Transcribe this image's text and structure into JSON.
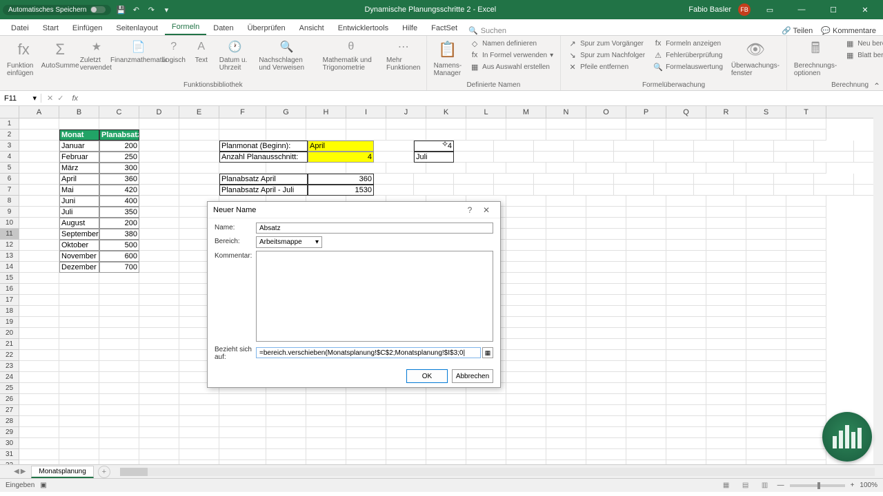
{
  "titlebar": {
    "autosave": "Automatisches Speichern",
    "title": "Dynamische Planungsschritte 2 - Excel",
    "user_name": "Fabio Basler",
    "user_initials": "FB"
  },
  "tabs": {
    "datei": "Datei",
    "start": "Start",
    "einfuegen": "Einfügen",
    "seitenlayout": "Seitenlayout",
    "formeln": "Formeln",
    "daten": "Daten",
    "ueberpruefen": "Überprüfen",
    "ansicht": "Ansicht",
    "entwicklertools": "Entwicklertools",
    "hilfe": "Hilfe",
    "factset": "FactSet",
    "suchen": "Suchen",
    "teilen": "Teilen",
    "kommentare": "Kommentare"
  },
  "ribbon": {
    "funktion_einfuegen": "Funktion einfügen",
    "autosumme": "AutoSumme",
    "zuletzt_verwendet": "Zuletzt verwendet",
    "finanzmathematik": "Finanzmathematik",
    "logisch": "Logisch",
    "text": "Text",
    "datum_uhrzeit": "Datum u. Uhrzeit",
    "nachschlagen": "Nachschlagen und Verweisen",
    "mathematik": "Mathematik und Trigonometrie",
    "mehr_funktionen": "Mehr Funktionen",
    "group_funktionsbibliothek": "Funktionsbibliothek",
    "namens_manager": "Namens-Manager",
    "namen_definieren": "Namen definieren",
    "in_formel_verwenden": "In Formel verwenden",
    "aus_auswahl_erstellen": "Aus Auswahl erstellen",
    "group_definierte_namen": "Definierte Namen",
    "spur_vorgaenger": "Spur zum Vorgänger",
    "spur_nachfolger": "Spur zum Nachfolger",
    "pfeile_entfernen": "Pfeile entfernen",
    "formeln_anzeigen": "Formeln anzeigen",
    "fehlerueberpruefung": "Fehlerüberprüfung",
    "formelauswertung": "Formelauswertung",
    "ueberwachungsfenster": "Überwachungs-fenster",
    "group_formelueberwachung": "Formelüberwachung",
    "berechnungsoptionen": "Berechnungs-optionen",
    "neu_berechnen": "Neu berechnen",
    "blatt_berechnen": "Blatt berechnen",
    "group_berechnung": "Berechnung"
  },
  "formula_bar": {
    "name_box": "F11"
  },
  "columns": [
    "A",
    "B",
    "C",
    "D",
    "E",
    "F",
    "G",
    "H",
    "I",
    "J",
    "K",
    "L",
    "M",
    "N",
    "O",
    "P",
    "Q",
    "R",
    "S",
    "T"
  ],
  "table": {
    "header_month": "Monat",
    "header_plan": "Planabsatz",
    "rows": [
      {
        "m": "Januar",
        "v": "200"
      },
      {
        "m": "Februar",
        "v": "250"
      },
      {
        "m": "März",
        "v": "300"
      },
      {
        "m": "April",
        "v": "360"
      },
      {
        "m": "Mai",
        "v": "420"
      },
      {
        "m": "Juni",
        "v": "400"
      },
      {
        "m": "Juli",
        "v": "350"
      },
      {
        "m": "August",
        "v": "200"
      },
      {
        "m": "September",
        "v": "380"
      },
      {
        "m": "Oktober",
        "v": "500"
      },
      {
        "m": "November",
        "v": "600"
      },
      {
        "m": "Dezember",
        "v": "700"
      }
    ]
  },
  "plan": {
    "planmonat_label": "Planmonat (Beginn):",
    "planmonat_value": "April",
    "anzahl_label": "Anzahl Planausschnitt:",
    "anzahl_value": "4",
    "planabsatz_april_label": "Planabsatz April",
    "planabsatz_april_value": "360",
    "planabsatz_range_label": "Planabsatz April - Juli",
    "planabsatz_range_value": "1530",
    "i3_value": "4",
    "i4_value": "Juli"
  },
  "dialog": {
    "title": "Neuer Name",
    "name_label": "Name:",
    "name_value": "Absatz",
    "bereich_label": "Bereich:",
    "bereich_value": "Arbeitsmappe",
    "kommentar_label": "Kommentar:",
    "bezieht_label": "Bezieht sich auf:",
    "bezieht_value": "=bereich.verschieben(Monatsplanung!$C$2;Monatsplanung!$I$3;0|",
    "ok": "OK",
    "abbrechen": "Abbrechen"
  },
  "sheet": {
    "name": "Monatsplanung"
  },
  "status": {
    "mode": "Eingeben",
    "zoom": "100%"
  }
}
